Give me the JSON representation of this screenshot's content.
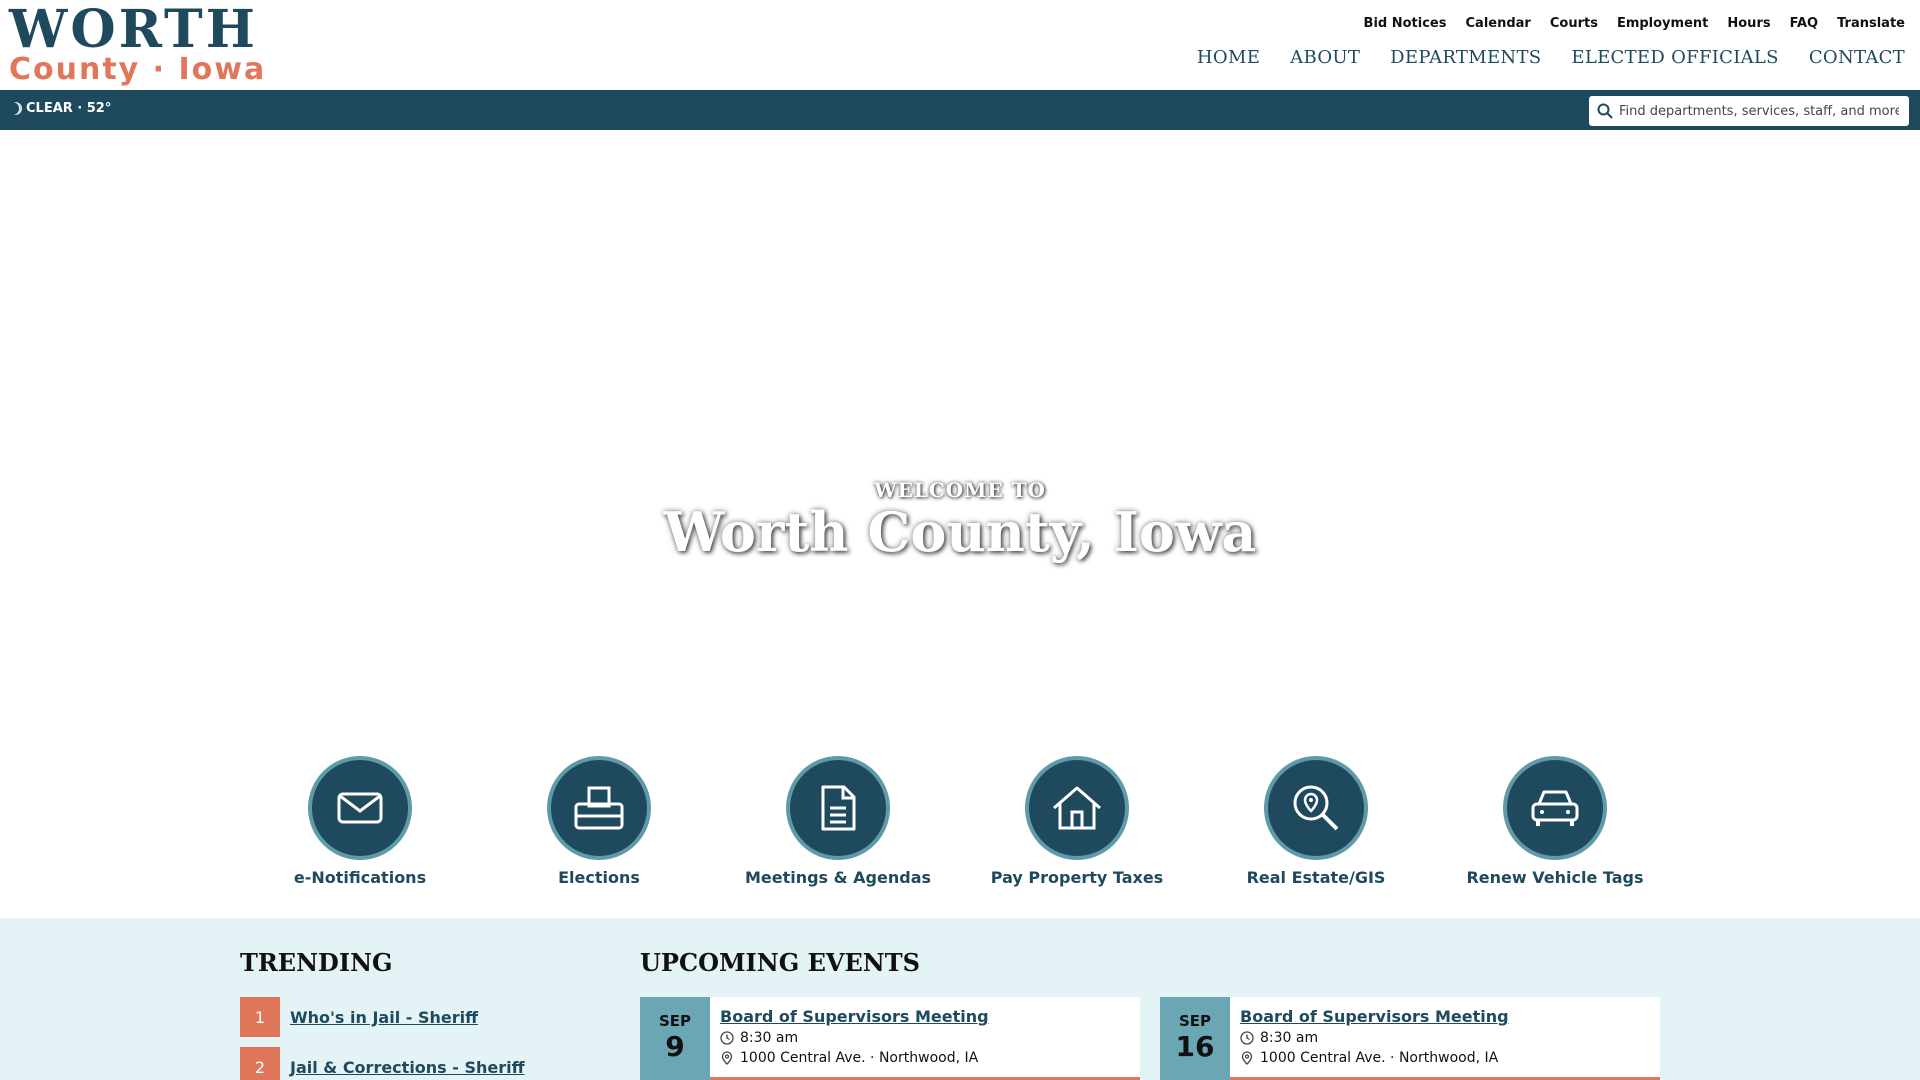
{
  "logo": {
    "top": "WORTH",
    "bottom": "County · Iowa"
  },
  "utility_nav": [
    "Bid Notices",
    "Calendar",
    "Courts",
    "Employment",
    "Hours",
    "FAQ",
    "Translate"
  ],
  "main_nav": [
    "HOME",
    "ABOUT",
    "DEPARTMENTS",
    "ELECTED OFFICIALS",
    "CONTACT"
  ],
  "weather": {
    "text": "CLEAR · 52°",
    "icon": "moon-icon"
  },
  "search": {
    "placeholder": "Find departments, services, staff, and more...",
    "icon": "search-icon"
  },
  "hero": {
    "welcome": "WELCOME TO",
    "title": "Worth County, Iowa"
  },
  "quick_links": [
    {
      "label": "e-Notifications",
      "icon": "envelope-icon"
    },
    {
      "label": "Elections",
      "icon": "ballot-box-icon"
    },
    {
      "label": "Meetings & Agendas",
      "icon": "document-icon"
    },
    {
      "label": "Pay Property Taxes",
      "icon": "house-icon"
    },
    {
      "label": "Real Estate/GIS",
      "icon": "map-search-icon"
    },
    {
      "label": "Renew Vehicle Tags",
      "icon": "car-icon"
    }
  ],
  "trending": {
    "title": "TRENDING",
    "items": [
      {
        "num": "1",
        "label": "Who's in Jail - Sheriff"
      },
      {
        "num": "2",
        "label": "Jail & Corrections - Sheriff"
      }
    ]
  },
  "events": {
    "title": "UPCOMING EVENTS",
    "items": [
      {
        "month": "SEP",
        "day": "9",
        "title": "Board of Supervisors Meeting",
        "time": "8:30 am",
        "location": "1000 Central Ave. · Northwood, IA"
      },
      {
        "month": "SEP",
        "day": "16",
        "title": "Board of Supervisors Meeting",
        "time": "8:30 am",
        "location": "1000 Central Ave. · Northwood, IA"
      }
    ]
  },
  "colors": {
    "primary": "#1f4a5e",
    "accent": "#e0775a",
    "band": "#e4f3f5",
    "date_box": "#6aa6b3"
  }
}
